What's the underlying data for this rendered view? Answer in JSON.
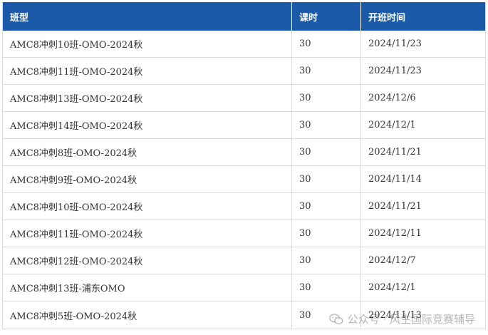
{
  "table": {
    "headers": [
      "班型",
      "课时",
      "开班时间"
    ],
    "rows": [
      [
        "AMC8冲刺10班-OMO-2024秋",
        "30",
        "2024/11/23"
      ],
      [
        "AMC8冲刺11班-OMO-2024秋",
        "30",
        "2024/11/23"
      ],
      [
        "AMC8冲刺13班-OMO-2024秋",
        "30",
        "2024/12/6"
      ],
      [
        "AMC8冲刺14班-OMO-2024秋",
        "30",
        "2024/12/1"
      ],
      [
        "AMC8冲刺8班-OMO-2024秋",
        "30",
        "2024/11/21"
      ],
      [
        "AMC8冲刺9班-OMO-2024秋",
        "30",
        "2024/11/14"
      ],
      [
        "AMC8冲刺10班-OMO-2024秋",
        "30",
        "2024/11/21"
      ],
      [
        "AMC8冲刺11班-OMO-2024秋",
        "30",
        "2024/12/11"
      ],
      [
        "AMC8冲刺12班-OMO-2024秋",
        "30",
        "2024/12/7"
      ],
      [
        "AMC8冲刺13班-浦东OMO",
        "30",
        "2024/12/1"
      ],
      [
        "AMC8冲刺5班-OMO-2024秋",
        "30",
        "2024/11/13"
      ]
    ]
  },
  "watermark": {
    "text": "公众号 · 风生国际竞赛辅导",
    "icon": "wechat-icon"
  }
}
